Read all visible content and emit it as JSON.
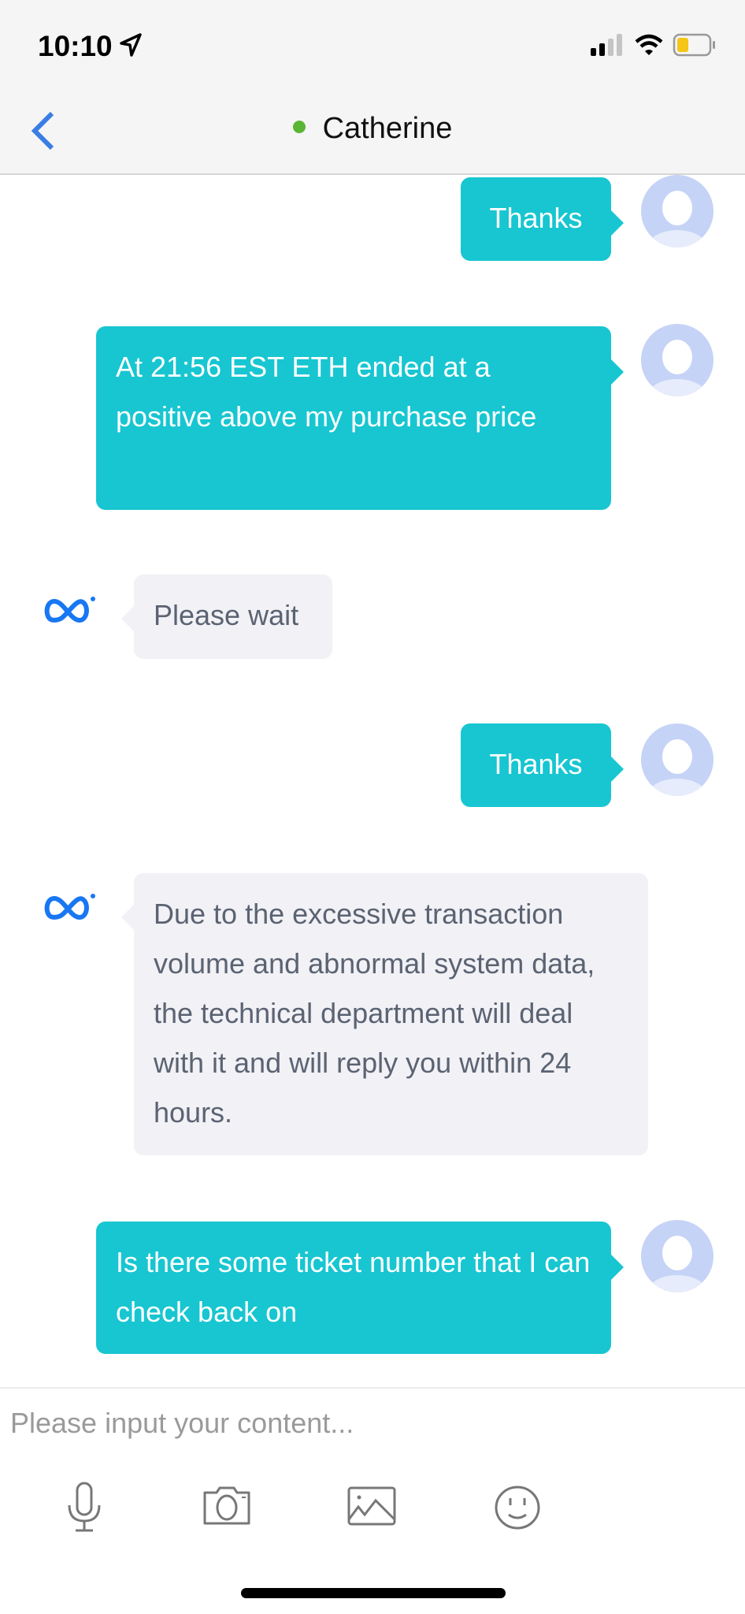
{
  "status_bar": {
    "time": "10:10",
    "battery_color": "#f5c518"
  },
  "header": {
    "contact_name": "Catherine",
    "online_color": "#5ab534",
    "accent": "#3a7ee4"
  },
  "messages": [
    {
      "direction": "outgoing",
      "text": "Thanks"
    },
    {
      "direction": "outgoing",
      "text": "At 21:56 EST ETH ended at a positive above my purchase price"
    },
    {
      "direction": "incoming",
      "text": "Please wait"
    },
    {
      "direction": "outgoing",
      "text": "Thanks"
    },
    {
      "direction": "incoming",
      "text": "Due to the excessive transaction volume and abnormal system data, the technical department will deal with it and will reply you within 24 hours."
    },
    {
      "direction": "outgoing",
      "text": "Is there some ticket number that I can check back on"
    }
  ],
  "composer": {
    "placeholder": "Please input your content...",
    "tools": [
      "microphone-icon",
      "camera-icon",
      "image-icon",
      "emoji-icon"
    ]
  },
  "colors": {
    "outgoing_bubble": "#17c6d1",
    "incoming_bubble": "#f1f1f6"
  }
}
